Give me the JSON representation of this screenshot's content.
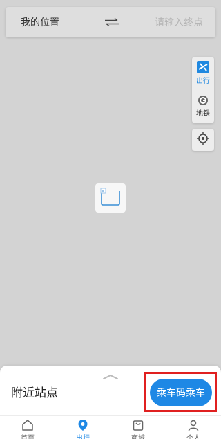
{
  "route": {
    "from_label": "我的位置",
    "to_placeholder": "请输入终点"
  },
  "side_panel": {
    "items": [
      {
        "label": "出行",
        "icon": "transit-icon",
        "active": true
      },
      {
        "label": "地铁",
        "icon": "metro-icon",
        "active": false
      }
    ]
  },
  "bottom_sheet": {
    "title": "附近站点",
    "qr_button_label": "乘车码乘车"
  },
  "tabs": [
    {
      "label": "首页",
      "icon": "home-icon",
      "active": false
    },
    {
      "label": "出行",
      "icon": "location-pin-icon",
      "active": true
    },
    {
      "label": "商城",
      "icon": "shopping-bag-icon",
      "active": false
    },
    {
      "label": "个人",
      "icon": "person-icon",
      "active": false
    }
  ],
  "colors": {
    "accent": "#1e88e5",
    "highlight": "#e02020",
    "map_background": "#d3d3d3"
  }
}
